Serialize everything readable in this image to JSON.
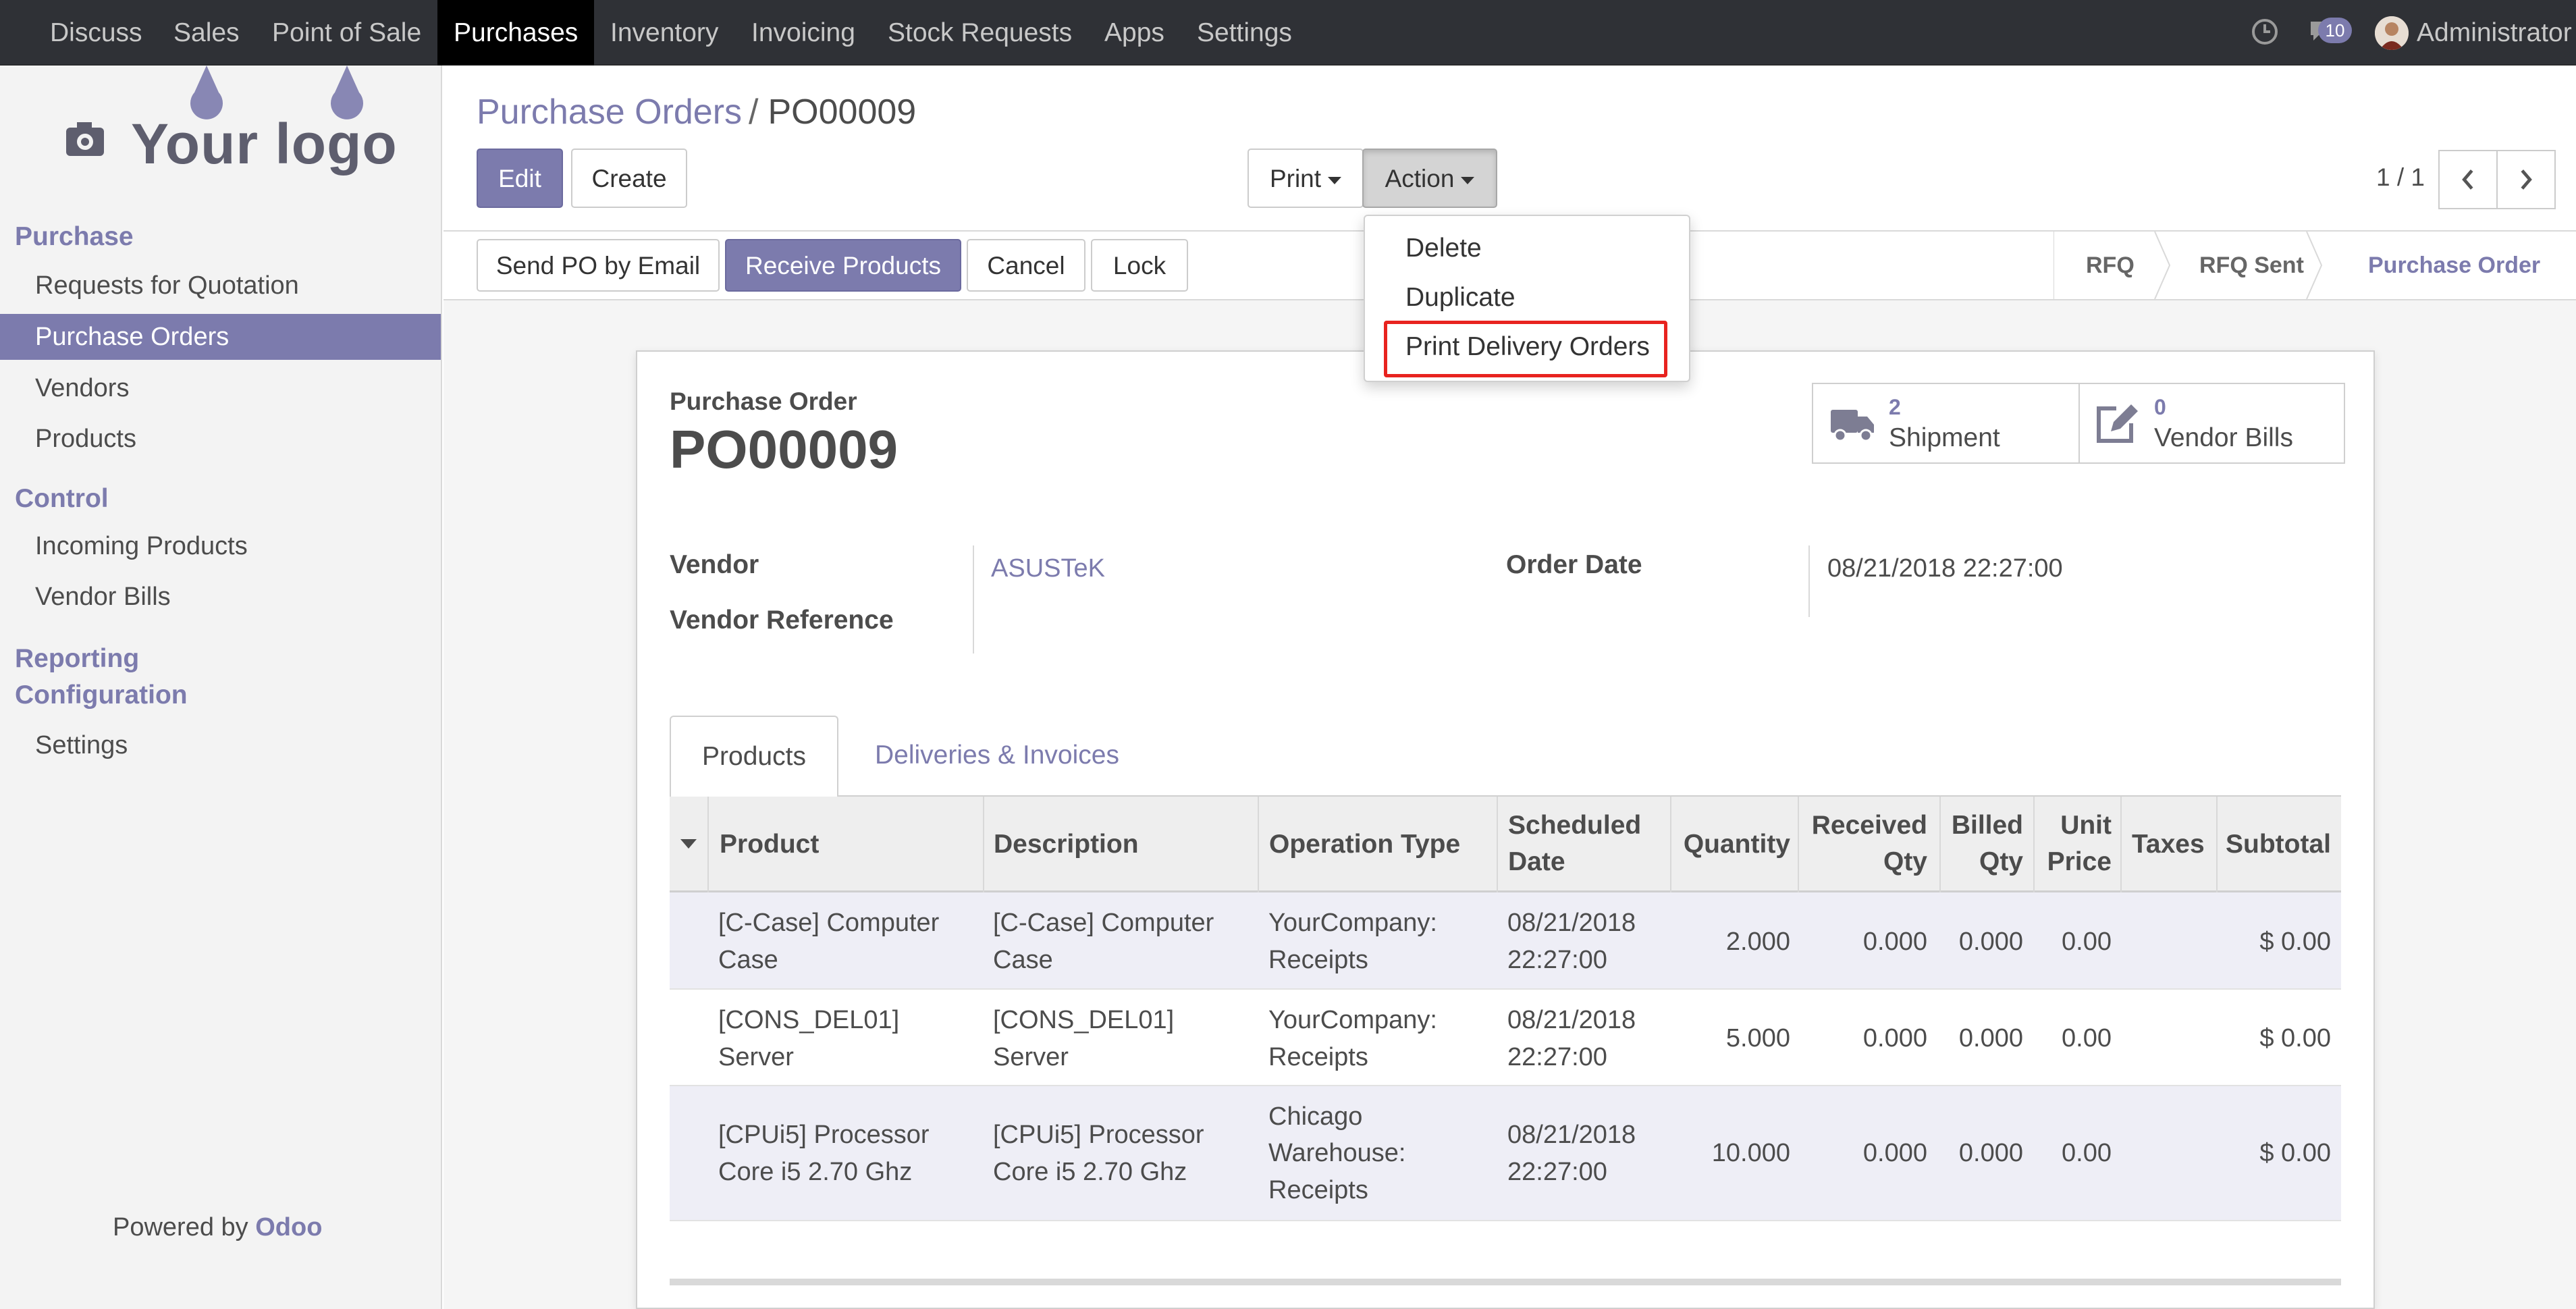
{
  "topnav": {
    "menu": [
      "Discuss",
      "Sales",
      "Point of Sale",
      "Purchases",
      "Inventory",
      "Invoicing",
      "Stock Requests",
      "Apps",
      "Settings"
    ],
    "active": "Purchases",
    "message_count": "10",
    "user": "Administrator"
  },
  "sidebar": {
    "logo_text": "Your logo",
    "section_purchase": "Purchase",
    "items_purchase": [
      "Requests for Quotation",
      "Purchase Orders",
      "Vendors",
      "Products"
    ],
    "section_control": "Control",
    "items_control": [
      "Incoming Products",
      "Vendor Bills"
    ],
    "section_reporting": "Reporting",
    "section_configuration": "Configuration",
    "items_configuration": [
      "Settings"
    ],
    "powered_prefix": "Powered by",
    "powered_brand": "Odoo"
  },
  "breadcrumb": {
    "parent": "Purchase Orders",
    "separator": "/",
    "current": "PO00009"
  },
  "buttons": {
    "edit": "Edit",
    "create": "Create",
    "print": "Print",
    "action": "Action"
  },
  "pager": {
    "text": "1 / 1"
  },
  "action_menu": {
    "items": [
      "Delete",
      "Duplicate",
      "Print Delivery Orders"
    ]
  },
  "statusbar": {
    "buttons": [
      "Send PO by Email",
      "Receive Products",
      "Cancel",
      "Lock"
    ],
    "stages": [
      "RFQ",
      "RFQ Sent",
      "Purchase Order"
    ],
    "current_stage": "Purchase Order"
  },
  "form": {
    "doc_label": "Purchase Order",
    "doc_name": "PO00009",
    "smart_buttons": [
      {
        "count": "2",
        "label": "Shipment",
        "icon": "truck-icon"
      },
      {
        "count": "0",
        "label": "Vendor Bills",
        "icon": "pencil-square-icon"
      }
    ],
    "vendor_label": "Vendor",
    "vendor_value": "ASUSTeK",
    "vendor_ref_label": "Vendor Reference",
    "order_date_label": "Order Date",
    "order_date_value": "08/21/2018 22:27:00"
  },
  "tabs": [
    "Products",
    "Deliveries & Invoices"
  ],
  "table": {
    "columns": {
      "product": "Product",
      "description": "Description",
      "operation_type": "Operation Type",
      "scheduled_date_1": "Scheduled",
      "scheduled_date_2": "Date",
      "quantity": "Quantity",
      "received_1": "Received",
      "received_2": "Qty",
      "billed_1": "Billed",
      "billed_2": "Qty",
      "unit_price_1": "Unit",
      "unit_price_2": "Price",
      "taxes": "Taxes",
      "subtotal": "Subtotal"
    },
    "rows": [
      {
        "product": [
          "[C-Case] Computer",
          "Case"
        ],
        "description": [
          "[C-Case] Computer",
          "Case"
        ],
        "operation": [
          "YourCompany:",
          "Receipts"
        ],
        "date": [
          "08/21/2018",
          "22:27:00"
        ],
        "quantity": "2.000",
        "received": "0.000",
        "billed": "0.000",
        "unit_price": "0.00",
        "subtotal": "$ 0.00"
      },
      {
        "product": [
          "[CONS_DEL01]",
          "Server"
        ],
        "description": [
          "[CONS_DEL01]",
          "Server"
        ],
        "operation": [
          "YourCompany:",
          "Receipts"
        ],
        "date": [
          "08/21/2018",
          "22:27:00"
        ],
        "quantity": "5.000",
        "received": "0.000",
        "billed": "0.000",
        "unit_price": "0.00",
        "subtotal": "$ 0.00"
      },
      {
        "product": [
          "[CPUi5] Processor",
          "Core i5 2.70 Ghz"
        ],
        "description": [
          "[CPUi5] Processor",
          "Core i5 2.70 Ghz"
        ],
        "operation": [
          "Chicago",
          "Warehouse:",
          "Receipts"
        ],
        "date": [
          "08/21/2018",
          "22:27:00"
        ],
        "quantity": "10.000",
        "received": "0.000",
        "billed": "0.000",
        "unit_price": "0.00",
        "subtotal": "$ 0.00"
      }
    ]
  },
  "colors": {
    "brand": "#7c7bad",
    "navbar": "#2f3136",
    "highlight": "#e8231f"
  }
}
